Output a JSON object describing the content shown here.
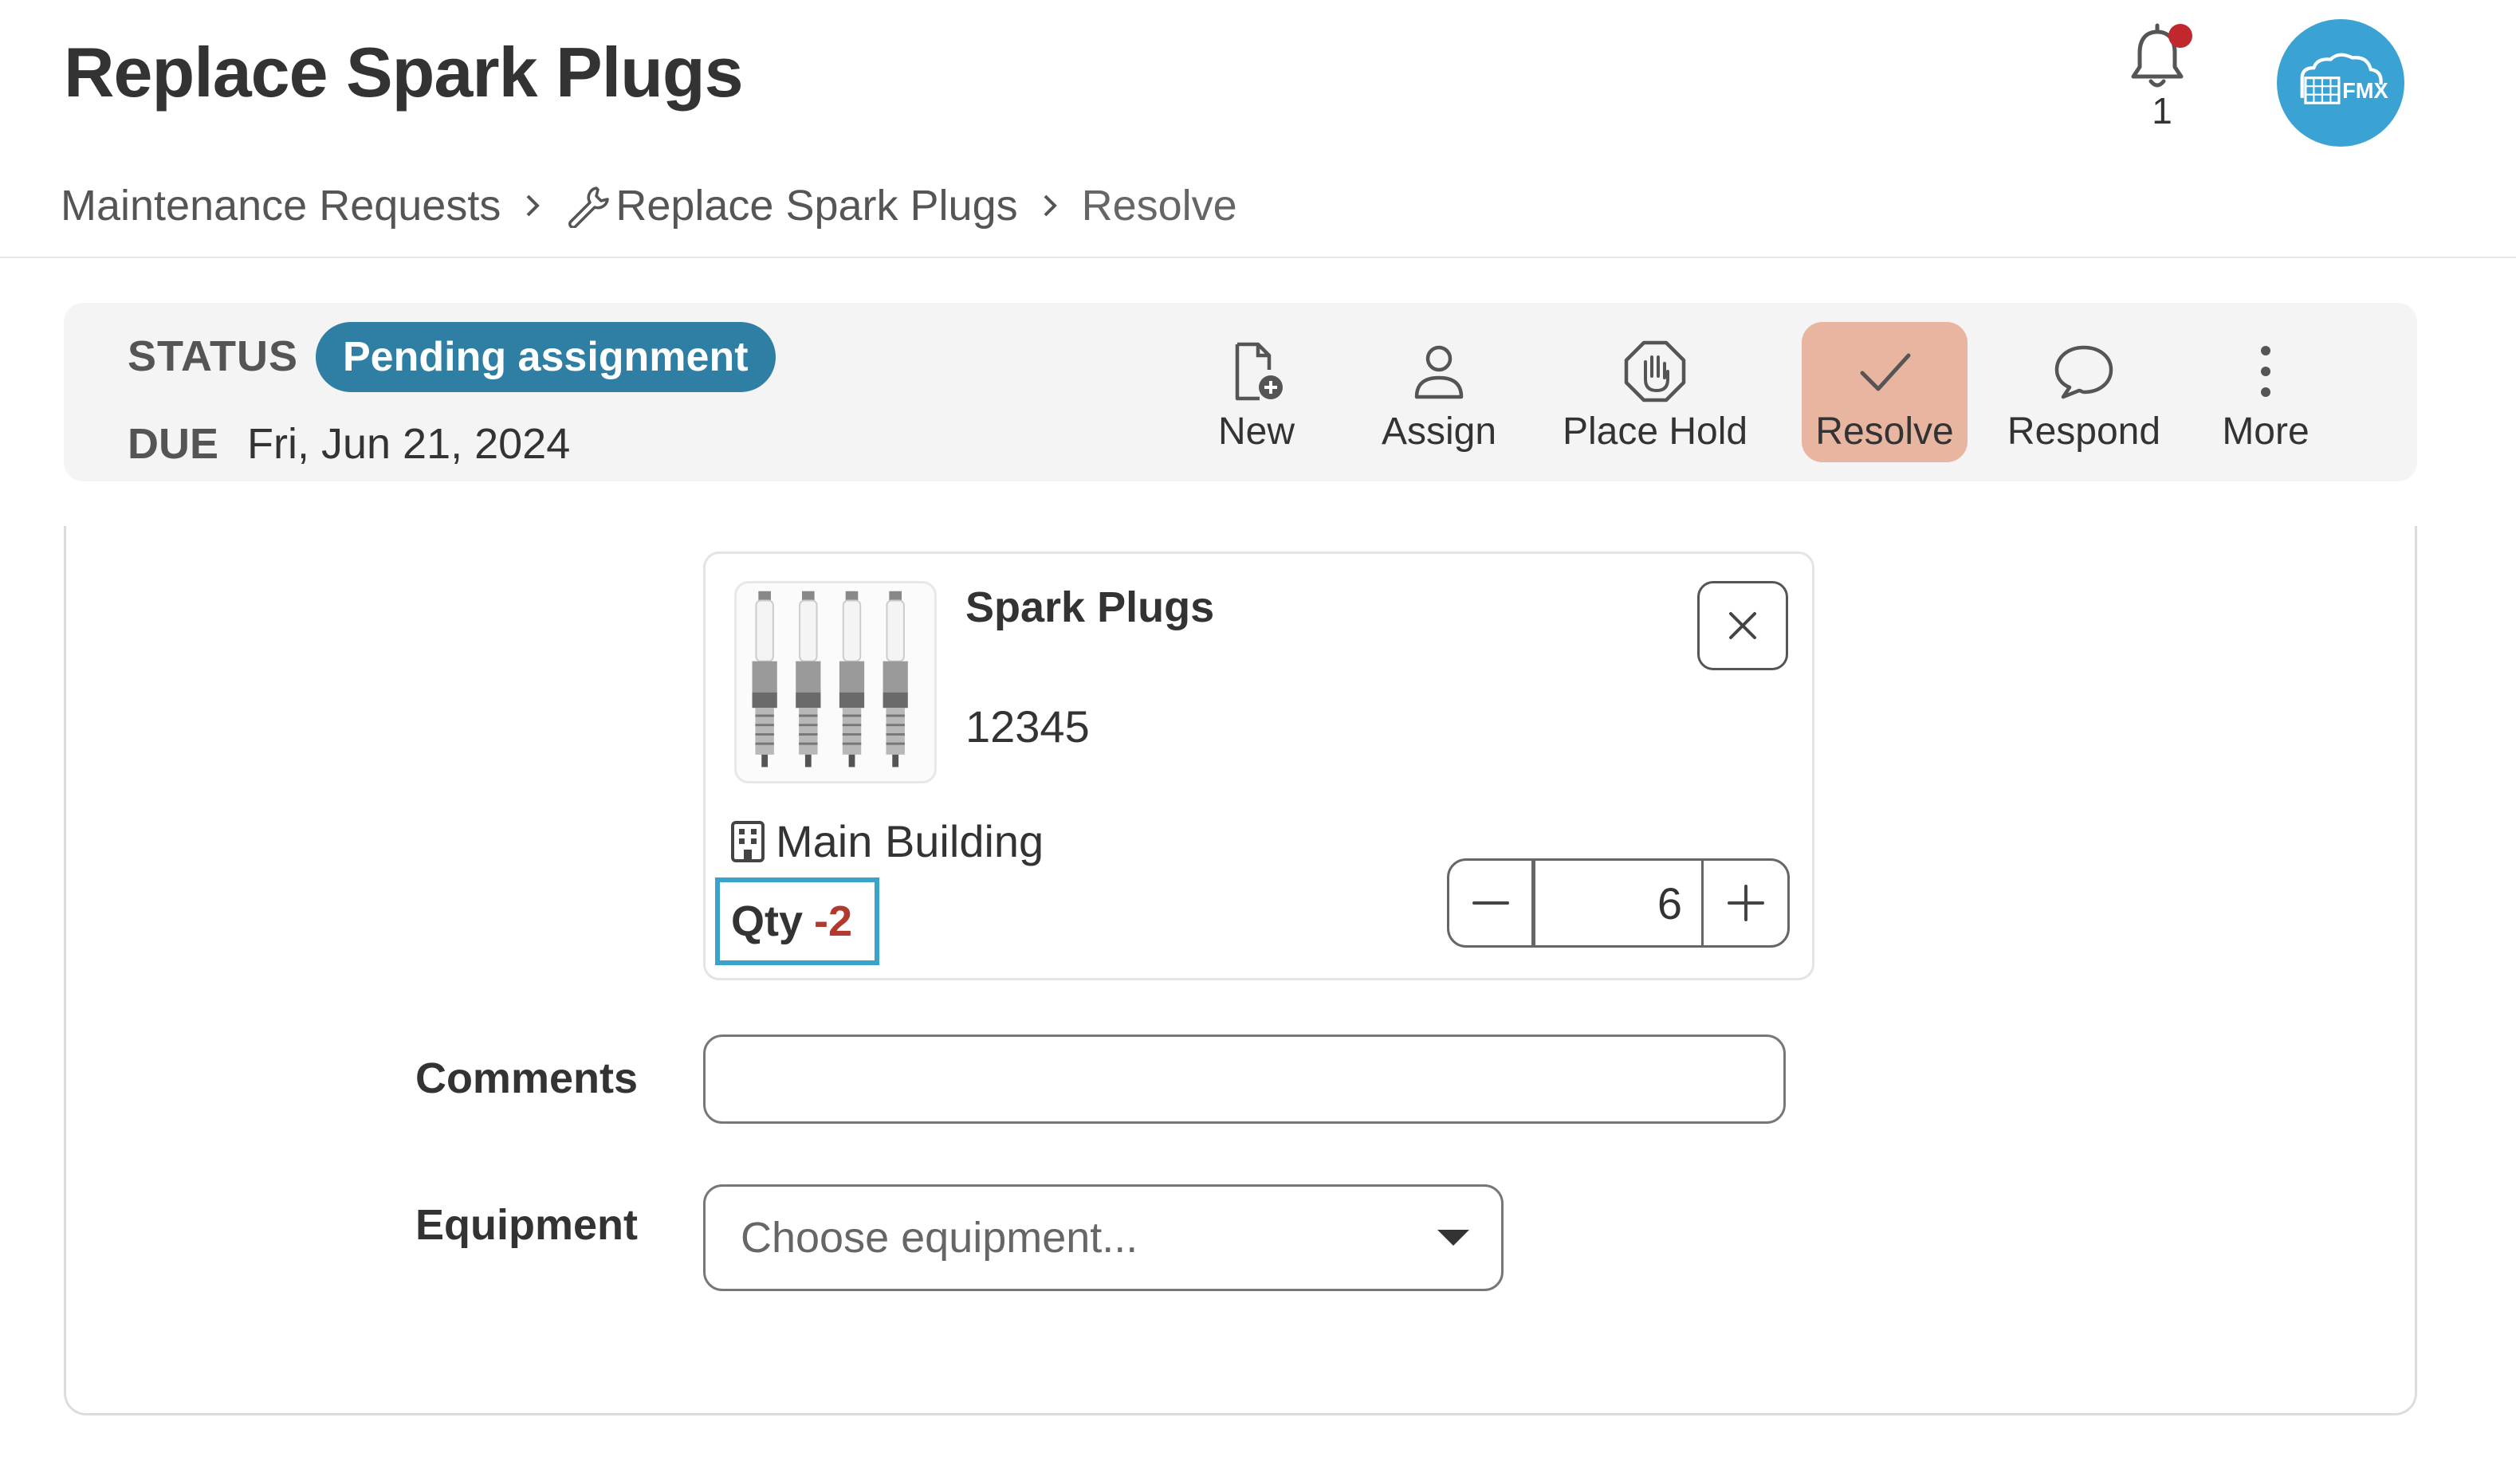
{
  "header": {
    "title": "Replace Spark Plugs",
    "notifications": {
      "icon": "bell-icon",
      "count": "1",
      "dot_color": "#c0282d"
    },
    "avatar": {
      "icon": "fmx-logo-icon",
      "color": "#3aa3d4"
    }
  },
  "breadcrumb": {
    "items": [
      "Maintenance Requests",
      "Replace Spark Plugs",
      "Resolve"
    ],
    "item2_icon": "wrench-icon"
  },
  "status": {
    "label": "STATUS",
    "value": "Pending assignment",
    "badge_color": "#2e7fa3",
    "due_label": "DUE",
    "due_value": "Fri, Jun 21, 2024"
  },
  "actions": [
    {
      "label": "New",
      "icon": "new-document-icon"
    },
    {
      "label": "Assign",
      "icon": "person-icon"
    },
    {
      "label": "Place Hold",
      "icon": "hand-stop-icon"
    },
    {
      "label": "Resolve",
      "icon": "check-icon",
      "active": true,
      "active_color": "#e8b5a0"
    },
    {
      "label": "Respond",
      "icon": "speech-bubble-icon"
    },
    {
      "label": "More",
      "icon": "vertical-dots-icon"
    }
  ],
  "part": {
    "name": "Spark Plugs",
    "number": "12345",
    "location": "Main Building",
    "location_icon": "building-icon",
    "qty_label": "Qty",
    "qty_value": "-2",
    "qty_value_color": "#b03a2e",
    "quantity": "6"
  },
  "form": {
    "comments_label": "Comments",
    "comments_value": "",
    "equipment_label": "Equipment",
    "equipment_placeholder": "Choose equipment..."
  }
}
